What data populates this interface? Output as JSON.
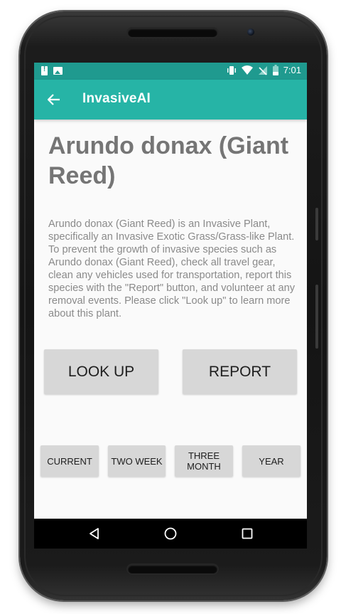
{
  "status_bar": {
    "time": "7:01",
    "left_icons": [
      "alert-icon",
      "image-icon"
    ],
    "right_icons": [
      "vibrate-icon",
      "wifi-icon",
      "no-signal-icon",
      "battery-icon"
    ]
  },
  "app_bar": {
    "title": "InvasiveAI",
    "back_icon": "arrow-left-icon",
    "color": "#26b4a6"
  },
  "content": {
    "title": "Arundo donax (Giant Reed)",
    "description": "Arundo donax (Giant Reed) is an Invasive Plant, specifically an Invasive Exotic Grass/Grass-like Plant. To prevent the growth of invasive species such as Arundo donax (Giant Reed), check all travel gear, clean any vehicles used for transportation, report this species with the \"Report\" button, and volunteer at any removal events. Please click \"Look up\" to learn more about this plant."
  },
  "actions": {
    "look_up": "LOOK UP",
    "report": "REPORT"
  },
  "ranges": {
    "current": "CURRENT",
    "two_week": "TWO WEEK",
    "three_month": "THREE MONTH",
    "year": "YEAR"
  },
  "nav_bar": {
    "back": "back-triangle-icon",
    "home": "home-circle-icon",
    "recents": "recents-square-icon"
  }
}
